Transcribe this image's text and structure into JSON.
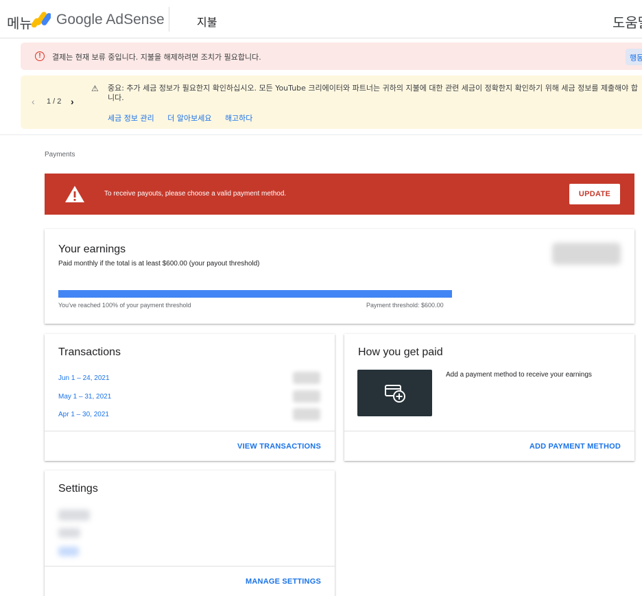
{
  "topbar": {
    "menu_label": "메뉴",
    "brand_google": "Google",
    "brand_product": "AdSense",
    "section_title": "지불",
    "help_label": "도움말"
  },
  "alerts": {
    "hold": {
      "icon": "error-icon",
      "text": "결제는 현재 보류 중입니다. 지불을 해제하려면 조치가 필요합니다.",
      "action_label": "행동"
    },
    "tax": {
      "pager": "1 / 2",
      "icon": "warning-icon",
      "text": "중요: 추가 세금 정보가 필요한지 확인하십시오. 모든 YouTube 크리에이터와 파트너는 귀하의 지불에 대한 관련 세금이 정확한지 확인하기 위해 세금 정보를 제출해야 합니다.",
      "links": [
        "세금 정보 관리",
        "더 알아보세요",
        "해고하다"
      ]
    }
  },
  "breadcrumb": "Payments",
  "banner": {
    "text": "To receive payouts, please choose a valid payment method.",
    "button": "UPDATE",
    "color": "#c5392b"
  },
  "earnings": {
    "title": "Your earnings",
    "subtitle": "Paid monthly if the total is at least $600.00 (your payout threshold)",
    "progress_percent": 100,
    "reached_text": "You've reached 100% of your payment threshold",
    "threshold_text": "Payment threshold: $600.00",
    "bar_color": "#4285f4"
  },
  "transactions": {
    "title": "Transactions",
    "rows": [
      "Jun 1 – 24, 2021",
      "May 1 – 31, 2021",
      "Apr 1 – 30, 2021"
    ],
    "footer_link": "VIEW TRANSACTIONS"
  },
  "how_paid": {
    "title": "How you get paid",
    "tile_icon": "add-payment-card-icon",
    "description": "Add a payment method to receive your earnings",
    "footer_link": "ADD PAYMENT METHOD"
  },
  "settings": {
    "title": "Settings",
    "footer_link": "MANAGE SETTINGS"
  }
}
